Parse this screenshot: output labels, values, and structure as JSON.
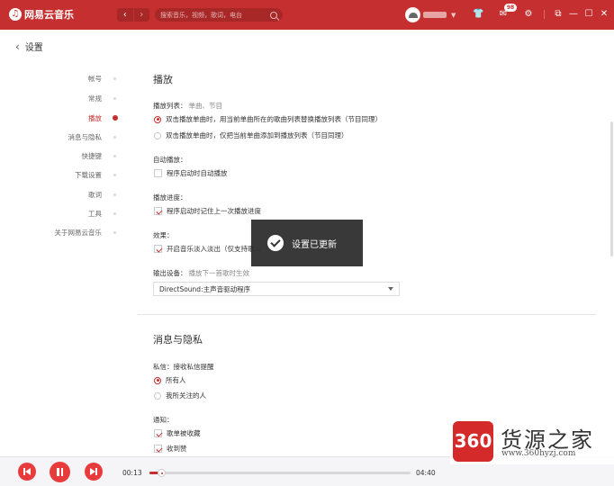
{
  "titlebar": {
    "app_name": "网易云音乐",
    "search_placeholder": "搜索音乐，视频，歌词，电台",
    "message_count": "98",
    "nav_back_label": "‹",
    "nav_forward_label": "›"
  },
  "page": {
    "back_title": "设置"
  },
  "sidenav": [
    {
      "label": "帐号",
      "active": false
    },
    {
      "label": "常规",
      "active": false
    },
    {
      "label": "播放",
      "active": true
    },
    {
      "label": "消息与隐私",
      "active": false
    },
    {
      "label": "快捷键",
      "active": false
    },
    {
      "label": "下载设置",
      "active": false
    },
    {
      "label": "歌词",
      "active": false
    },
    {
      "label": "工具",
      "active": false
    },
    {
      "label": "关于网易云音乐",
      "active": false
    }
  ],
  "playback": {
    "heading": "播放",
    "playlist_label": "播放列表：",
    "playlist_sub": "单曲、节目",
    "playlist_opt1": "双击播放单曲时，用当前单曲所在的歌曲列表替换播放列表（节目同理）",
    "playlist_opt2": "双击播放单曲时，仅把当前单曲添加到播放列表（节目同理）",
    "autoplay_label": "自动播放：",
    "autoplay_opt": "程序启动时自动播放",
    "progress_label": "播放进度：",
    "progress_opt": "程序启动时记住上一次播放进度",
    "effects_label": "效果：",
    "effects_opt": "开启音乐淡入淡出（仅支持歌…",
    "output_label": "输出设备：",
    "output_sub": "播放下一首歌时生效",
    "output_value": "DirectSound:主声音驱动程序"
  },
  "toast": {
    "text": "设置已更新"
  },
  "privacy": {
    "heading": "消息与隐私",
    "dm_label": "私信：",
    "dm_sub": "接收私信提醒",
    "dm_opt1": "所有人",
    "dm_opt2": "我所关注的人",
    "notify_label": "通知：",
    "notify_opt1": "歌单被收藏",
    "notify_opt2": "收到赞"
  },
  "player": {
    "elapsed": "00:13",
    "duration": "04:40",
    "progress_fraction": 0.047
  },
  "watermark": {
    "logo_text": "360",
    "brand": "货源之家",
    "url": "www.360hyzj.com"
  },
  "colors": {
    "accent": "#c62f2f",
    "player_button": "#e83c3c"
  }
}
